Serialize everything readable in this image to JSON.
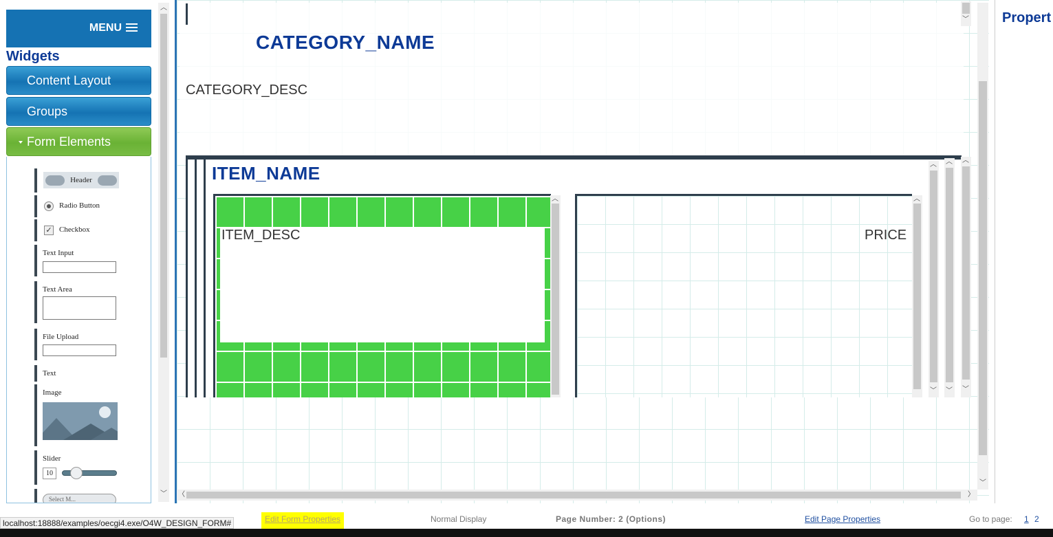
{
  "sidebar": {
    "menu_label": "MENU",
    "widgets_title": "Widgets",
    "accordion": [
      {
        "label": "Content Layout"
      },
      {
        "label": "Groups"
      },
      {
        "label": "Form Elements"
      }
    ],
    "form_elements": {
      "header": "Header",
      "radio": "Radio Button",
      "checkbox": "Checkbox",
      "text_input": "Text Input",
      "text_area": "Text Area",
      "file_upload": "File Upload",
      "text": "Text",
      "image": "Image",
      "slider": "Slider",
      "slider_value": "10",
      "select_stub": "Select M..."
    }
  },
  "canvas": {
    "category_name": "CATEGORY_NAME",
    "category_desc": "CATEGORY_DESC",
    "item_name": "ITEM_NAME",
    "item_desc": "ITEM_DESC",
    "price": "PRICE"
  },
  "properties": {
    "title": "Propert"
  },
  "status": {
    "url": "localhost:18888/examples/oecgi4.exe/O4W_DESIGN_FORM#",
    "edit_form": "Edit Form Properties",
    "normal_display": "Normal Display",
    "page_number": "Page Number:   2 (Options)",
    "edit_page": "Edit Page Properties",
    "goto": "Go to page:",
    "pages": [
      "1",
      "2"
    ]
  },
  "colors": {
    "menu_blue": "#1572b3",
    "heading_blue": "#0d3a96",
    "accordion_green": "#6ab235",
    "cell_green": "#47d147",
    "highlight_yellow": "#ffff00"
  }
}
